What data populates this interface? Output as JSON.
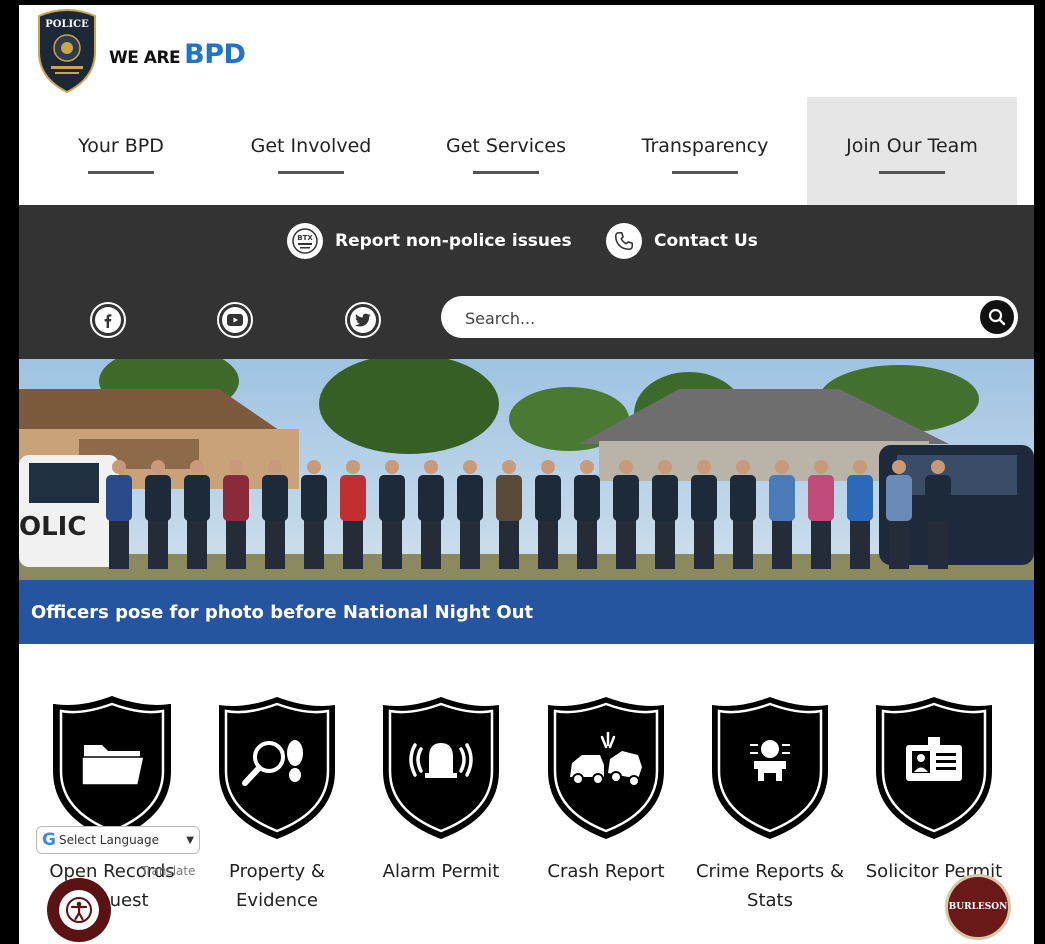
{
  "header": {
    "brand_prefix": "WE ARE",
    "brand_name": "BPD",
    "badge_text": "POLICE"
  },
  "nav": [
    {
      "label": "Your BPD",
      "active": false
    },
    {
      "label": "Get Involved",
      "active": false
    },
    {
      "label": "Get Services",
      "active": false
    },
    {
      "label": "Transparency",
      "active": false
    },
    {
      "label": "Join Our Team",
      "active": true
    }
  ],
  "quick_links": {
    "report_label": "Report non-police issues",
    "report_icon": "btx-icon",
    "contact_label": "Contact Us",
    "contact_icon": "phone-icon"
  },
  "social": [
    {
      "name": "facebook-icon"
    },
    {
      "name": "youtube-icon"
    },
    {
      "name": "twitter-icon"
    }
  ],
  "search": {
    "placeholder": "Search...",
    "value": ""
  },
  "hero": {
    "caption": "Officers pose for photo before National Night Out"
  },
  "services": [
    {
      "label": "Open Records Request",
      "icon": "folder-icon"
    },
    {
      "label": "Property & Evidence",
      "icon": "magnifier-footprint-icon"
    },
    {
      "label": "Alarm Permit",
      "icon": "alarm-bell-icon"
    },
    {
      "label": "Crash Report",
      "icon": "car-crash-icon"
    },
    {
      "label": "Crime Reports & Stats",
      "icon": "crime-stats-icon"
    },
    {
      "label": "Solicitor Permit",
      "icon": "id-card-icon"
    }
  ],
  "translate": {
    "select_label": "Select Language",
    "powered_by": "Translate"
  },
  "footer_widgets": {
    "accessibility_icon": "accessibility-icon",
    "seal_text": "BURLESON"
  },
  "colors": {
    "accent_blue": "#1f73c8",
    "caption_blue": "#2554a0",
    "dark_bar": "#333333",
    "active_nav": "#e6e6e6"
  }
}
